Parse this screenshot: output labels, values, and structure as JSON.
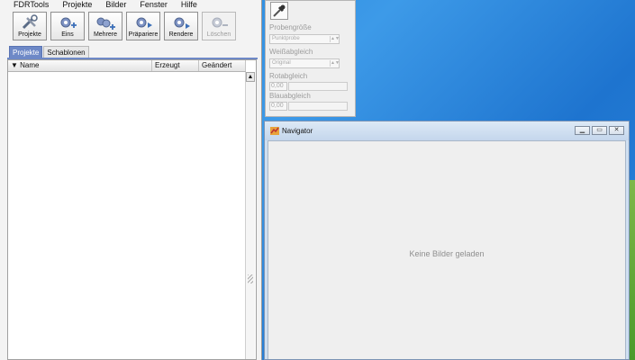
{
  "menubar": {
    "items": [
      "FDRTools",
      "Projekte",
      "Bilder",
      "Fenster",
      "Hilfe"
    ]
  },
  "toolbar": {
    "buttons": [
      {
        "label": "Projekte",
        "icon": "tools-icon"
      },
      {
        "label": "Eins",
        "icon": "gear-add-icon"
      },
      {
        "label": "Mehrere",
        "icon": "gears-add-icon"
      },
      {
        "label": "Präpariere",
        "icon": "gear-play-icon"
      },
      {
        "label": "Rendere",
        "icon": "gear-render-icon"
      },
      {
        "label": "Löschen",
        "icon": "gear-remove-icon",
        "disabled": true
      }
    ]
  },
  "tabs": [
    "Projekte",
    "Schablonen"
  ],
  "table": {
    "columns": [
      "Name",
      "Erzeugt",
      "Geändert"
    ]
  },
  "settings": {
    "sample_size_label": "Probengröße",
    "sample_size_value": "Punktprobe",
    "white_balance_label": "Weißabgleich",
    "white_balance_value": "Original",
    "red_label": "Rotabgleich",
    "red_value": "0,00",
    "blue_label": "Blauabgleich",
    "blue_value": "0,00"
  },
  "navigator": {
    "title": "Navigator",
    "empty_message": "Keine Bilder geladen"
  },
  "colors": {
    "accent": "#6e89c7",
    "desktop": "#1d7fd8"
  }
}
